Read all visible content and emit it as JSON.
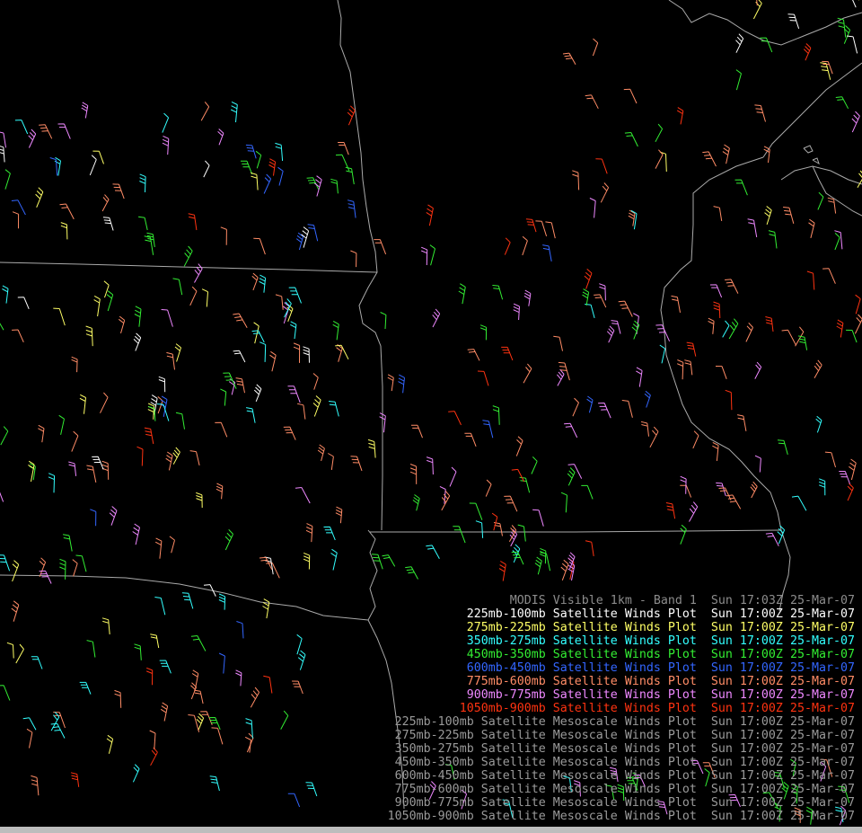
{
  "map": {
    "background_color": "#000000",
    "boundary_color": "#aaaaaa",
    "legend_lines": [
      {
        "text": "MODIS Visible 1km - Band 1  Sun 17:03Z 25-Mar-07",
        "color": "#8c8c8c"
      },
      {
        "text": "225mb-100mb Satellite Winds Plot  Sun 17:00Z 25-Mar-07",
        "color": "#ffffff"
      },
      {
        "text": "275mb-225mb Satellite Winds Plot  Sun 17:00Z 25-Mar-07",
        "color": "#ffff66"
      },
      {
        "text": "350mb-275mb Satellite Winds Plot  Sun 17:00Z 25-Mar-07",
        "color": "#33ffff"
      },
      {
        "text": "450mb-350mb Satellite Winds Plot  Sun 17:00Z 25-Mar-07",
        "color": "#33ee33"
      },
      {
        "text": "600mb-450mb Satellite Winds Plot  Sun 17:00Z 25-Mar-07",
        "color": "#3366ff"
      },
      {
        "text": "775mb-600mb Satellite Winds Plot  Sun 17:00Z 25-Mar-07",
        "color": "#ff8c66"
      },
      {
        "text": "900mb-775mb Satellite Winds Plot  Sun 17:00Z 25-Mar-07",
        "color": "#ee88ff"
      },
      {
        "text": "1050mb-900mb Satellite Winds Plot  Sun 17:00Z 25-Mar-07",
        "color": "#ff3311"
      },
      {
        "text": "225mb-100mb Satellite Mesoscale Winds Plot  Sun 17:00Z 25-Mar-07",
        "color": "#9a9a9a"
      },
      {
        "text": "275mb-225mb Satellite Mesoscale Winds Plot  Sun 17:00Z 25-Mar-07",
        "color": "#9a9a9a"
      },
      {
        "text": "350mb-275mb Satellite Mesoscale Winds Plot  Sun 17:00Z 25-Mar-07",
        "color": "#9a9a9a"
      },
      {
        "text": "450mb-350mb Satellite Mesoscale Winds Plot  Sun 17:00Z 25-Mar-07",
        "color": "#9a9a9a"
      },
      {
        "text": "600mb-450mb Satellite Mesoscale Winds Plot  Sun 17:00Z 25-Mar-07",
        "color": "#9a9a9a"
      },
      {
        "text": "775mb-600mb Satellite Mesoscale Winds Plot  Sun 17:00Z 25-Mar-07",
        "color": "#9a9a9a"
      },
      {
        "text": "900mb-775mb Satellite Mesoscale Winds Plot  Sun 17:00Z 25-Mar-07",
        "color": "#9a9a9a"
      },
      {
        "text": "1050mb-900mb Satellite Mesoscale Winds Plot  Sun 17:00Z 25-Mar-07",
        "color": "#9a9a9a"
      }
    ]
  }
}
